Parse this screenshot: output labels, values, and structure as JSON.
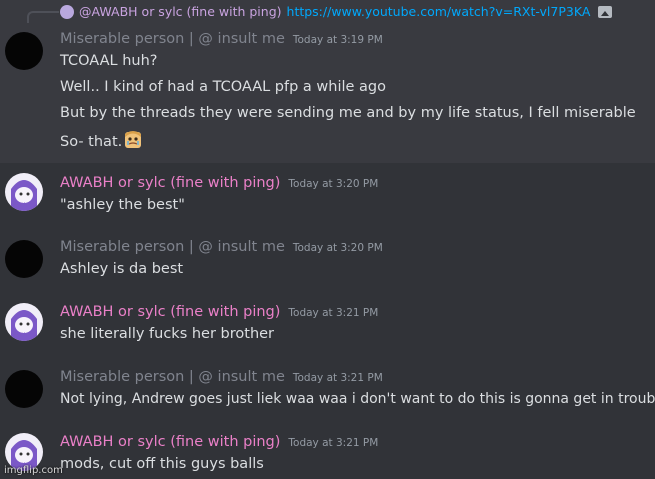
{
  "reply": {
    "author": "@AWABH or sylc (fine with ping)",
    "link": "https://www.youtube.com/watch?v=RXt-vl7P3KA",
    "attachment_icon": "image-icon"
  },
  "messages": [
    {
      "author": "Miserable person | @ insult me",
      "timestamp": "Today at 3:19 PM",
      "lines": [
        "TCOAAL huh?",
        "Well.. I kind of had a TCOAAL pfp a while ago",
        "But by the threads they were sending me and by my life status, I fell miserable",
        "So- that."
      ]
    },
    {
      "author": "AWABH or sylc (fine with ping)",
      "timestamp": "Today at 3:20 PM",
      "lines": [
        "\"ashley the best\""
      ]
    },
    {
      "author": "Miserable person | @ insult me",
      "timestamp": "Today at 3:20 PM",
      "lines": [
        "Ashley is da best"
      ]
    },
    {
      "author": "AWABH or sylc (fine with ping)",
      "timestamp": "Today at 3:21 PM",
      "lines": [
        "she literally fucks her brother"
      ]
    },
    {
      "author": "Miserable person | @ insult me",
      "timestamp": "Today at 3:21 PM",
      "lines": [
        "Not lying, Andrew goes just liek waa waa i don't want to do this is gonna get in trouble!!"
      ]
    },
    {
      "author": "AWABH or sylc (fine with ping)",
      "timestamp": "Today at 3:21 PM",
      "lines": [
        "mods, cut off this guys balls"
      ]
    }
  ],
  "watermark": "imgflip.com",
  "colors": {
    "background": "#313338",
    "highlight": "#393a40",
    "miserable_name": "#80848e",
    "awabh_name": "#ea80c8",
    "link": "#00a8fc"
  }
}
